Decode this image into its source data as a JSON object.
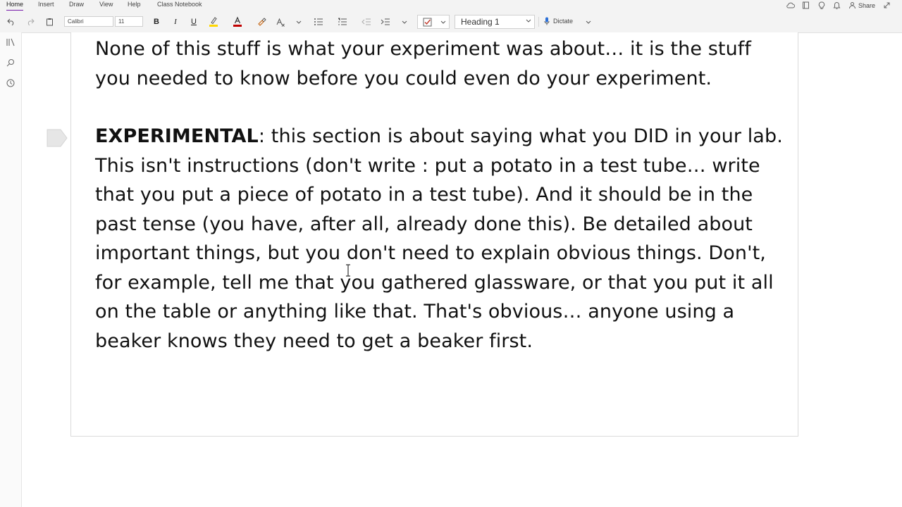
{
  "menu": {
    "tabs": [
      "Home",
      "Insert",
      "Draw",
      "View",
      "Help",
      "Class Notebook"
    ],
    "share_label": "Share"
  },
  "ribbon": {
    "font_name": "Calibri",
    "font_size": "11",
    "style_name": "Heading 1",
    "dictate_label": "Dictate"
  },
  "note": {
    "intro_paragraph": "None of this stuff is what your experiment was about… it is the stuff you needed to know before you could even do your experiment.",
    "experimental_heading": "EXPERIMENTAL",
    "experimental_body": ": this section is about saying what you DID in your lab. This isn't instructions (don't write : put a potato in a test tube… write that you put a piece of potato in a test tube).  And it should be in the past tense (you have, after all, already done this).  Be detailed about important things, but you don't need to explain obvious things. Don't, for example, tell me that you gathered glassware, or that you put it all on the table or anything like that. That's obvious… anyone using a beaker knows they need to get a beaker first."
  },
  "colors": {
    "accent": "#7719aa",
    "highlight": "#ffd700",
    "font_color": "#c00000",
    "checkbox": "#c0392b",
    "dictate_mic": "#2b6fd6"
  }
}
